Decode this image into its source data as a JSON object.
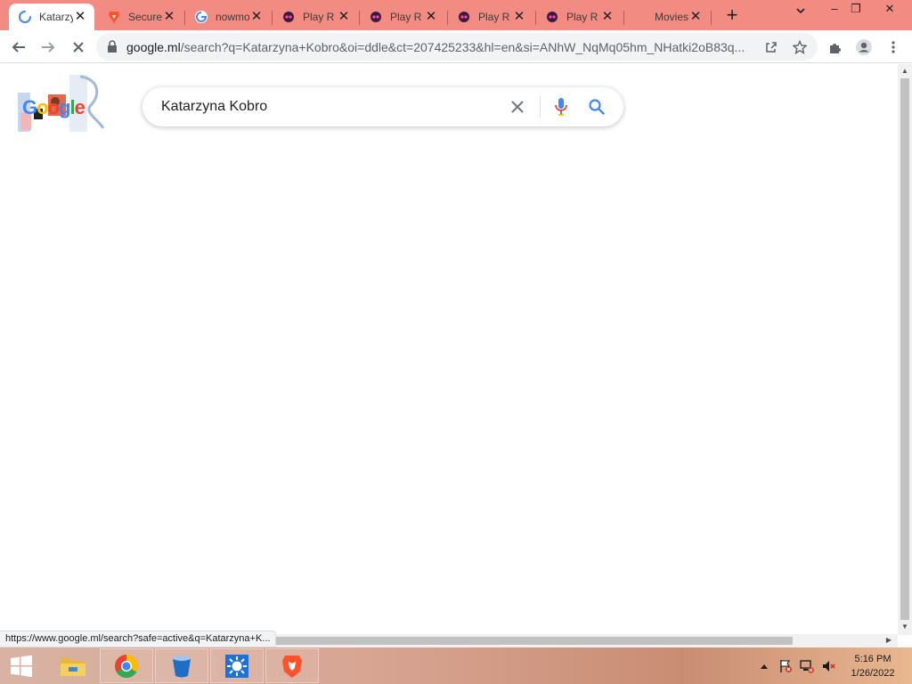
{
  "browser": {
    "tabs": [
      {
        "label": "Katarzyna Kobro",
        "favicon": "loading-spinner-icon",
        "active": true
      },
      {
        "label": "Secure",
        "favicon": "brave-shield-icon",
        "active": false
      },
      {
        "label": "nowmovies",
        "favicon": "google-g-icon",
        "active": false
      },
      {
        "label": "Play R",
        "favicon": "play-site-icon",
        "active": false
      },
      {
        "label": "Play R",
        "favicon": "play-site-icon",
        "active": false
      },
      {
        "label": "Play R",
        "favicon": "play-site-icon",
        "active": false
      },
      {
        "label": "Play R",
        "favicon": "play-site-icon",
        "active": false
      },
      {
        "label": "Movies",
        "favicon": "none",
        "active": false
      }
    ],
    "new_tab_label": "+",
    "window_controls": {
      "minimize": "–",
      "restore": "❐",
      "close": "✕"
    }
  },
  "toolbar": {
    "url_host": "google.ml",
    "url_rest": "/search?q=Katarzyna+Kobro&oi=ddle&ct=207425233&hl=en&si=ANhW_NqMq05hm_NHatki2oB83q..."
  },
  "page": {
    "doodle_text": "Google",
    "search_query": "Katarzyna Kobro"
  },
  "status_bar": {
    "link_url": "https://www.google.ml/search?safe=active&q=Katarzyna+K..."
  },
  "taskbar": {
    "apps": [
      "start-button",
      "file-explorer",
      "chrome",
      "recycle-bucket-app",
      "settings-sun-app",
      "brave-browser"
    ],
    "time": "5:16 PM",
    "date": "1/26/2022"
  },
  "colors": {
    "titlebar": "#f28b82",
    "google_blue": "#4285f4",
    "google_red": "#ea4335",
    "google_yellow": "#fbbc05",
    "google_green": "#34a853"
  }
}
